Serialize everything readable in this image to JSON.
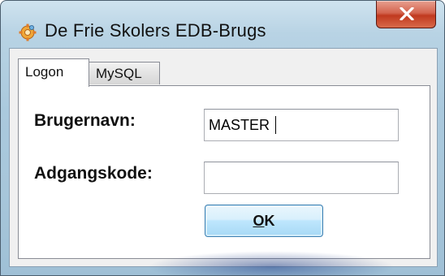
{
  "window": {
    "title": "De Frie Skolers EDB-Brugs",
    "close_label": "x"
  },
  "tabs": [
    {
      "label": "Logon",
      "active": true
    },
    {
      "label": "MySQL",
      "active": false
    }
  ],
  "form": {
    "username_label": "Brugernavn:",
    "username_value": "MASTER",
    "password_label": "Adgangskode:",
    "password_value": "",
    "ok_accel": "O",
    "ok_rest": "K"
  },
  "icons": {
    "app": "app-gear-icon",
    "close": "close-icon"
  },
  "colors": {
    "title_bar": "#aac9dd",
    "close_button": "#c0391f",
    "ok_button": "#bee6fd",
    "panel": "#ffffff"
  }
}
